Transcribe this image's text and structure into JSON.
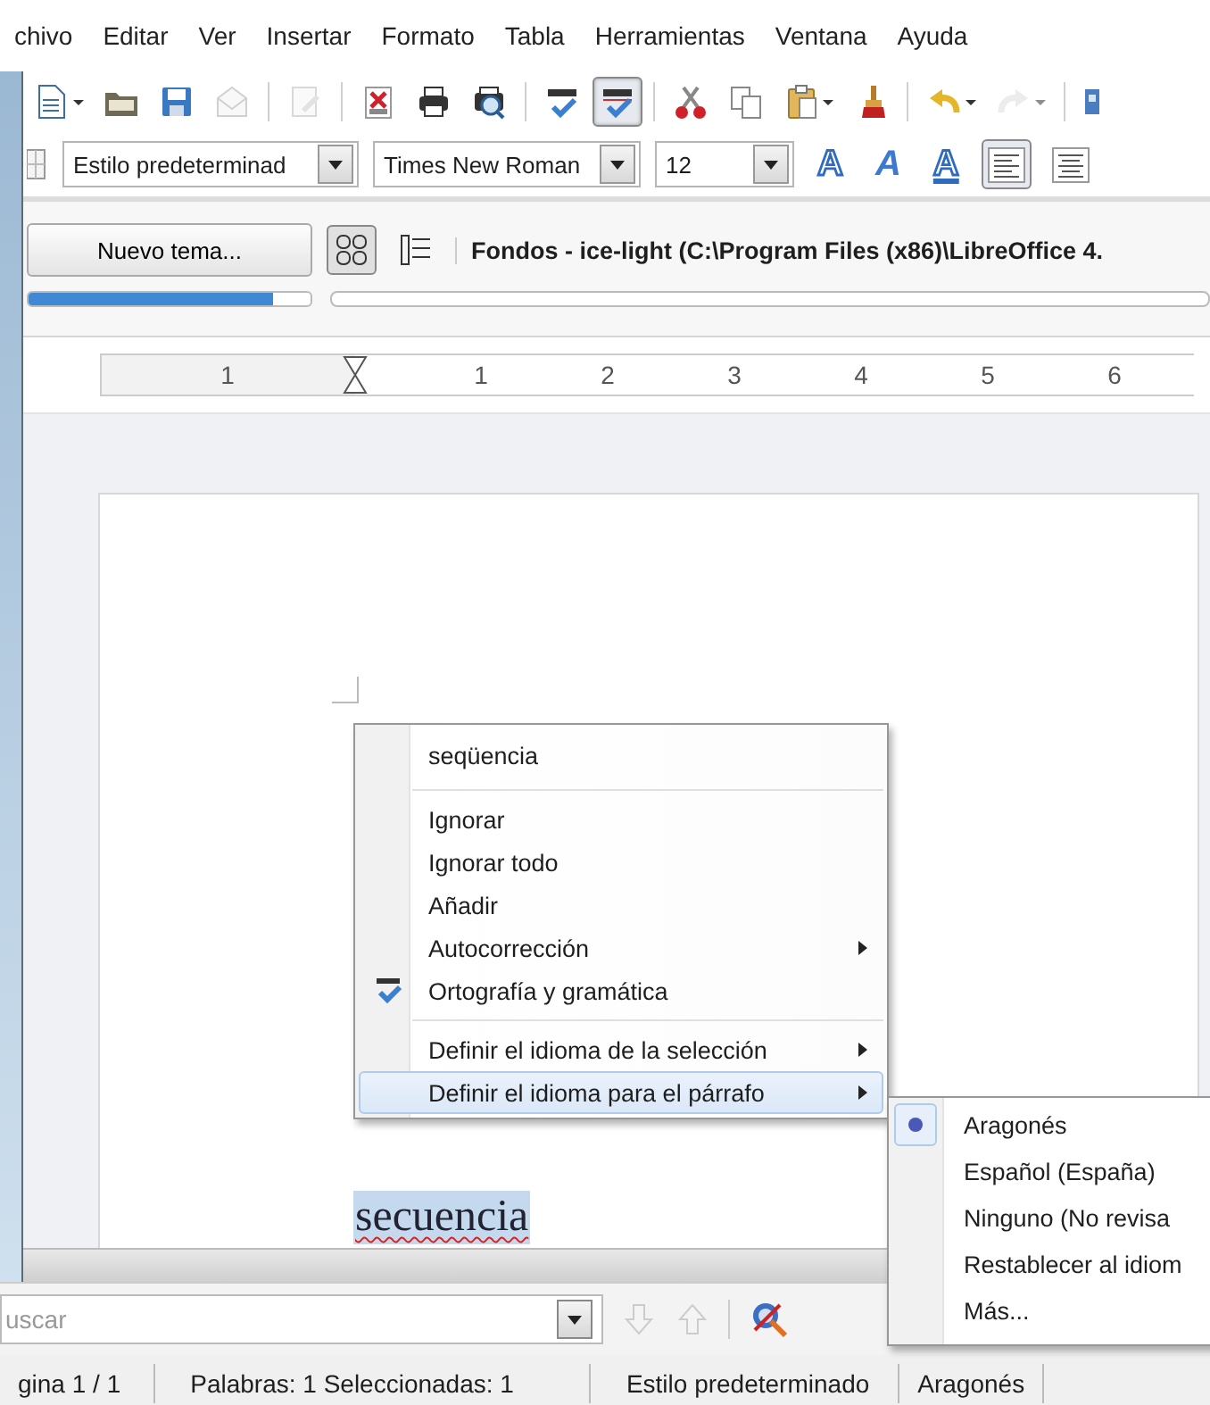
{
  "menubar": [
    {
      "label": "chivo"
    },
    {
      "label": "Editar"
    },
    {
      "label": "Ver"
    },
    {
      "label": "Insertar"
    },
    {
      "label": "Formato"
    },
    {
      "label": "Tabla"
    },
    {
      "label": "Herramientas"
    },
    {
      "label": "Ventana"
    },
    {
      "label": "Ayuda"
    }
  ],
  "standard_toolbar": [
    {
      "kind": "new",
      "dropdown": true,
      "disabled": false,
      "on": false
    },
    {
      "kind": "open",
      "dropdown": false,
      "disabled": false,
      "on": false
    },
    {
      "kind": "save",
      "dropdown": false,
      "disabled": false,
      "on": false
    },
    {
      "kind": "email",
      "dropdown": false,
      "disabled": true,
      "on": false
    },
    {
      "kind": "separator"
    },
    {
      "kind": "edit",
      "dropdown": false,
      "disabled": true,
      "on": false
    },
    {
      "kind": "separator"
    },
    {
      "kind": "pdf",
      "dropdown": false,
      "disabled": false,
      "on": false
    },
    {
      "kind": "print",
      "dropdown": false,
      "disabled": false,
      "on": false
    },
    {
      "kind": "preview",
      "dropdown": false,
      "disabled": false,
      "on": false
    },
    {
      "kind": "separator"
    },
    {
      "kind": "spellcheck",
      "dropdown": false,
      "disabled": false,
      "on": false
    },
    {
      "kind": "autospell",
      "dropdown": false,
      "disabled": false,
      "on": true
    },
    {
      "kind": "separator"
    },
    {
      "kind": "cut",
      "dropdown": false,
      "disabled": false,
      "on": false
    },
    {
      "kind": "copy",
      "dropdown": false,
      "disabled": false,
      "on": false
    },
    {
      "kind": "paste",
      "dropdown": true,
      "disabled": false,
      "on": false
    },
    {
      "kind": "brush",
      "dropdown": false,
      "disabled": false,
      "on": false
    },
    {
      "kind": "separator"
    },
    {
      "kind": "undo",
      "dropdown": true,
      "disabled": false,
      "on": false
    },
    {
      "kind": "redo",
      "dropdown": true,
      "disabled": true,
      "on": false
    },
    {
      "kind": "separator"
    },
    {
      "kind": "navigator",
      "dropdown": false,
      "disabled": false,
      "on": false
    }
  ],
  "formatting_toolbar": {
    "paragraph_style": "Estilo predeterminad",
    "font_name": "Times New Roman",
    "font_size": "12",
    "glyph_buttons": [
      {
        "glyph": "A",
        "kind": "outline"
      },
      {
        "glyph": "A",
        "kind": "italic"
      },
      {
        "glyph": "A",
        "kind": "underline"
      }
    ],
    "align_buttons": [
      {
        "kind": "left",
        "on": true
      },
      {
        "kind": "center",
        "on": false
      }
    ]
  },
  "gallery": {
    "new_theme_button": "Nuevo tema...",
    "level": 0.87,
    "views": [
      {
        "kind": "icons",
        "selected": true
      },
      {
        "kind": "list",
        "selected": false
      }
    ],
    "title": "Fondos - ice-light (C:\\Program Files (x86)\\LibreOffice 4."
  },
  "ruler": {
    "labels": [
      "1",
      "1",
      "2",
      "3",
      "4",
      "5",
      "6"
    ]
  },
  "document": {
    "selected_word": "secuencia",
    "misspelled": true
  },
  "context_menu": [
    {
      "kind": "suggestion",
      "label": "seqüencia",
      "selected": false
    },
    {
      "kind": "separator"
    },
    {
      "kind": "item",
      "label": "Ignorar",
      "selected": false
    },
    {
      "kind": "item",
      "label": "Ignorar todo",
      "selected": false
    },
    {
      "kind": "item",
      "label": "Añadir",
      "selected": false
    },
    {
      "kind": "submenu",
      "label": "Autocorrección",
      "selected": false
    },
    {
      "kind": "spelling",
      "label": "Ortografía y gramática",
      "selected": false
    },
    {
      "kind": "separator"
    },
    {
      "kind": "submenu",
      "label": "Definir el idioma de la selección",
      "selected": false
    },
    {
      "kind": "submenu",
      "label": "Definir el idioma para el párrafo",
      "selected": true
    }
  ],
  "language_submenu": [
    {
      "label": "Aragonés",
      "checked": true
    },
    {
      "label": "Español (España)",
      "checked": false
    },
    {
      "label": "Ninguno (No revisa",
      "checked": false
    },
    {
      "label": "Restablecer al idiom",
      "checked": false
    },
    {
      "label": "Más...",
      "checked": false
    }
  ],
  "find_bar": {
    "placeholder": "uscar"
  },
  "status_bar": [
    "gina 1 / 1",
    "Palabras: 1 Seleccionadas: 1",
    "Estilo predeterminado",
    "Aragonés"
  ]
}
